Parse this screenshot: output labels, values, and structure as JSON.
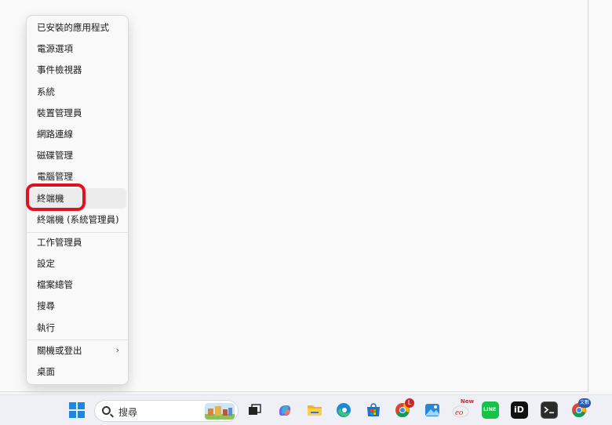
{
  "menu": {
    "items": [
      {
        "label": "已安裝的應用程式"
      },
      {
        "label": "電源選項"
      },
      {
        "label": "事件檢視器"
      },
      {
        "label": "系統"
      },
      {
        "label": "裝置管理員"
      },
      {
        "label": "網路連線"
      },
      {
        "label": "磁碟管理"
      },
      {
        "label": "電腦管理"
      },
      {
        "label": "終端機"
      },
      {
        "label": "終端機 (系統管理員)"
      },
      {
        "label": "工作管理員"
      },
      {
        "label": "設定"
      },
      {
        "label": "檔案總管"
      },
      {
        "label": "搜尋"
      },
      {
        "label": "執行"
      },
      {
        "label": "關機或登出"
      },
      {
        "label": "桌面"
      }
    ],
    "highlighted_item": "終端機",
    "submenu_chevron": "›"
  },
  "taskbar": {
    "search_placeholder": "搜尋",
    "icons": [
      "windows-start-icon",
      "task-view-icon",
      "copilot-icon",
      "file-explorer-icon",
      "edge-icon",
      "microsoft-store-icon",
      "chrome-icon",
      "photos-icon",
      "eclass-icon",
      "line-icon",
      "id-app-icon",
      "terminal-icon",
      "chrome-profile-icon"
    ],
    "chrome_badge": "L",
    "eclass_badge": "New",
    "line_label": "LINE",
    "id_label": "iD",
    "chrome_profile_badge": "文數"
  },
  "colors": {
    "highlight_ring": "#e0121b",
    "start_blue": "#1f86e0"
  }
}
